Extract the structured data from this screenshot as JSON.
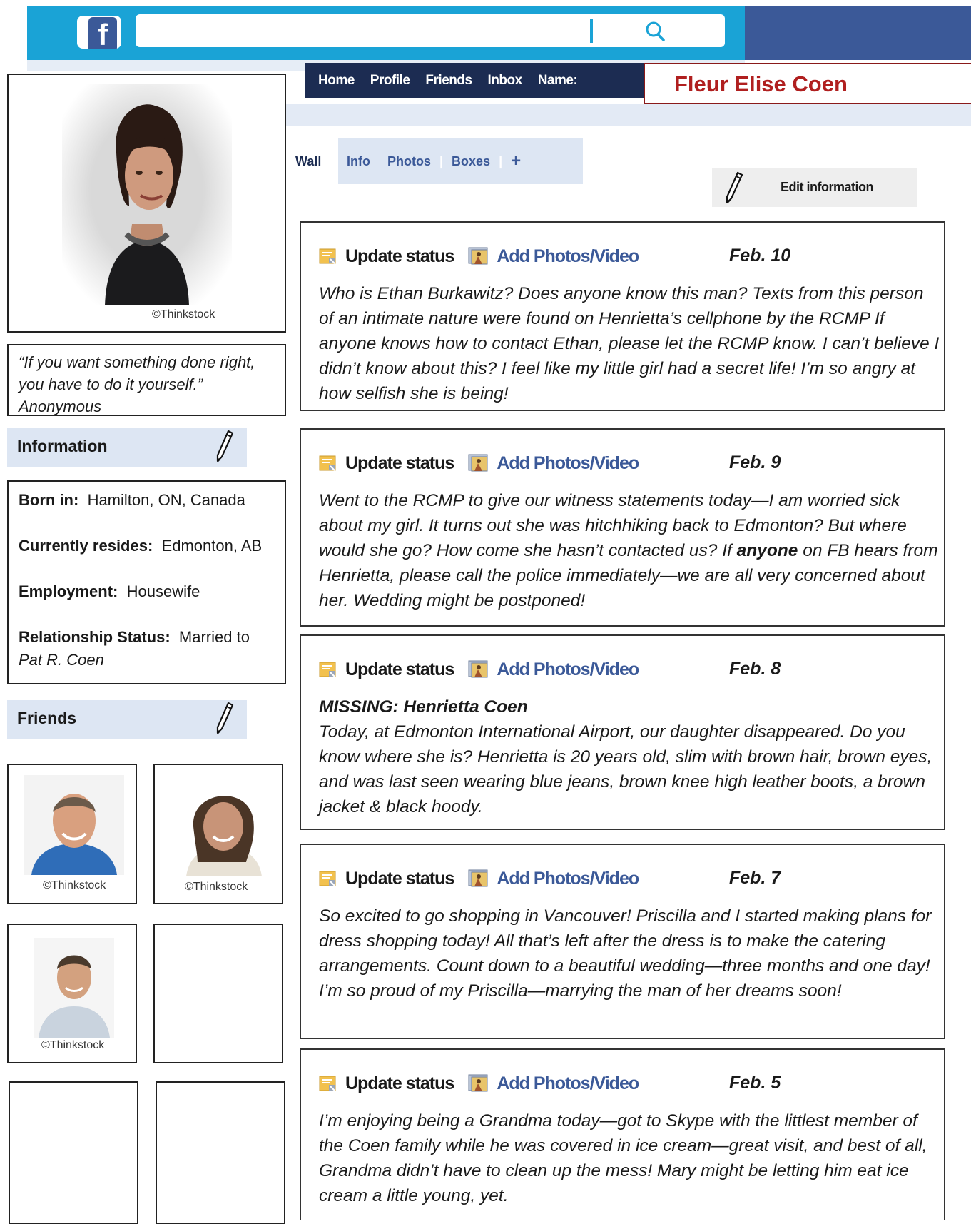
{
  "search": {
    "placeholder": ""
  },
  "nav": [
    "Home",
    "Profile",
    "Friends",
    "Inbox",
    "Name:"
  ],
  "profile_name": "Fleur Elise Coen",
  "tabs": [
    "Wall",
    "Info",
    "Photos",
    "Boxes"
  ],
  "tab_plus": "+",
  "edit_info_label": "Edit information",
  "photo_credit": "©Thinkstock",
  "quote": {
    "text": "“If you want something done right, you have to do it yourself.”",
    "author": "Anonymous"
  },
  "info": {
    "heading": "Information",
    "born_label": "Born in:",
    "born_value": "Hamilton, ON, Canada",
    "resides_label": "Currently resides:",
    "resides_value": "Edmonton, AB",
    "employment_label": "Employment:",
    "employment_value": "Housewife",
    "relationship_label": "Relationship Status:",
    "relationship_value": "Married to",
    "spouse": "Pat R. Coen"
  },
  "friends": {
    "heading": "Friends",
    "credits": [
      "©Thinkstock",
      "©Thinkstock",
      "©Thinkstock"
    ]
  },
  "post_actions": {
    "update": "Update status",
    "photos": "Add Photos/Video"
  },
  "posts": [
    {
      "date": "Feb. 10",
      "title": "",
      "text": "Who is Ethan Burkawitz?  Does anyone know this man?  Texts from this person of an intimate nature were found on Henrietta’s cellphone by the RCMP If anyone knows how to contact Ethan, please let the RCMP know.  I can’t believe I didn’t know about this?  I feel like my little girl had a secret life! I’m so angry at how selfish she is being!"
    },
    {
      "date": "Feb. 9",
      "title": "",
      "text_a": "Went to the RCMP to give our witness statements today—I am worried sick about my girl.  It turns out she was hitchhiking back to Edmonton? But where would she go?  How come she hasn’t contacted us?  If ",
      "text_bold": "anyone",
      "text_b": " on FB hears from Henrietta, please call the police immediately—we are all very concerned about her.  Wedding might be postponed!"
    },
    {
      "date": "Feb. 8",
      "title": "MISSING: Henrietta Coen",
      "text": "Today, at Edmonton International Airport, our daughter disappeared. Do you know where she is?  Henrietta is 20 years old, slim with brown hair, brown eyes, and was last seen wearing blue jeans, brown knee high leather boots, a brown jacket & black hoody."
    },
    {
      "date": "Feb. 7",
      "title": "",
      "text": "So excited to go shopping in Vancouver!  Priscilla and I started making plans for dress shopping today!  All that’s left after the dress is to make the catering arrangements.  Count down to a beautiful wedding—three months and one day!  I’m so proud of my Priscilla—marrying the man of her dreams soon!"
    },
    {
      "date": "Feb. 5",
      "title": "",
      "text": "I’m enjoying being a Grandma today—got to Skype with the littlest member of the Coen family while he was covered in ice cream—great visit, and best of all, Grandma didn’t have to clean up the mess!  Mary might be letting him eat ice cream a little young, yet."
    }
  ]
}
